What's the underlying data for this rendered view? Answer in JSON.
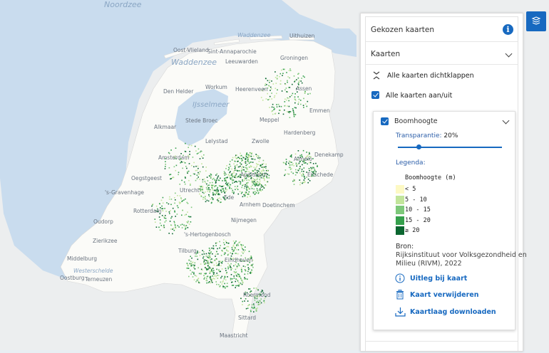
{
  "map": {
    "sea_labels": [
      "Noordzee",
      "Waddenzee",
      "Waddenzee",
      "IJsselmeer",
      "Westerschelde"
    ],
    "places": [
      "Uithuizen",
      "Oost-Vlieland",
      "Sint-Annaparochie",
      "Leeuwarden",
      "Groningen",
      "Heerenveen",
      "Assen",
      "Workum",
      "Den Helder",
      "Emmen",
      "Stede Broec",
      "Meppel",
      "Alkmaar",
      "Hardenberg",
      "Lelystad",
      "Zwolle",
      "Almelo",
      "Amsterdam",
      "Apeldoorn",
      "Denekamp",
      "Oegstgeest",
      "Enschede",
      "'s-Gravenhage",
      "Utrecht",
      "Ede",
      "Rotterdam",
      "Arnhem",
      "Doetinchem",
      "Oudorp",
      "Nijmegen",
      "Zierikzee",
      "'s-Hertogenbosch",
      "Tilburg",
      "Middelburg",
      "Eindhoven",
      "Oostburg",
      "Terneuzen",
      "Roermond",
      "Sittard",
      "Maastricht"
    ]
  },
  "panel": {
    "title": "Gekozen kaarten",
    "info_icon": "info-icon",
    "section_title": "Kaarten",
    "collapse_all": "Alle kaarten dichtklappen",
    "toggle_all": "Alle kaarten aan/uit",
    "toggle_all_checked": true
  },
  "layer": {
    "name": "Boomhoogte",
    "checked": true,
    "transparency_label": "Transparantie:",
    "transparency_value": "20%",
    "transparency_fraction": 0.2,
    "legend_label": "Legenda:",
    "legend_title": "Boomhoogte (m)",
    "legend": [
      {
        "label": "< 5",
        "color": "#fdf9c4"
      },
      {
        "label": "5 - 10",
        "color": "#c2e59b"
      },
      {
        "label": "10 - 15",
        "color": "#7dc87a"
      },
      {
        "label": "15 - 20",
        "color": "#35a04c"
      },
      {
        "label": "≥ 20",
        "color": "#0b6630"
      }
    ],
    "source_label": "Bron:",
    "source_text_1": "Rijksinstituut voor Volksgezondheid en",
    "source_text_2": "Milieu (RIVM), 2022",
    "action_explain": "Uitleg bij kaart",
    "action_remove": "Kaart verwijderen",
    "action_download": "Kaartlaag downloaden"
  },
  "colors": {
    "accent": "#1769c0",
    "sea": "#c5d9ec",
    "land": "#f7f7f5"
  }
}
